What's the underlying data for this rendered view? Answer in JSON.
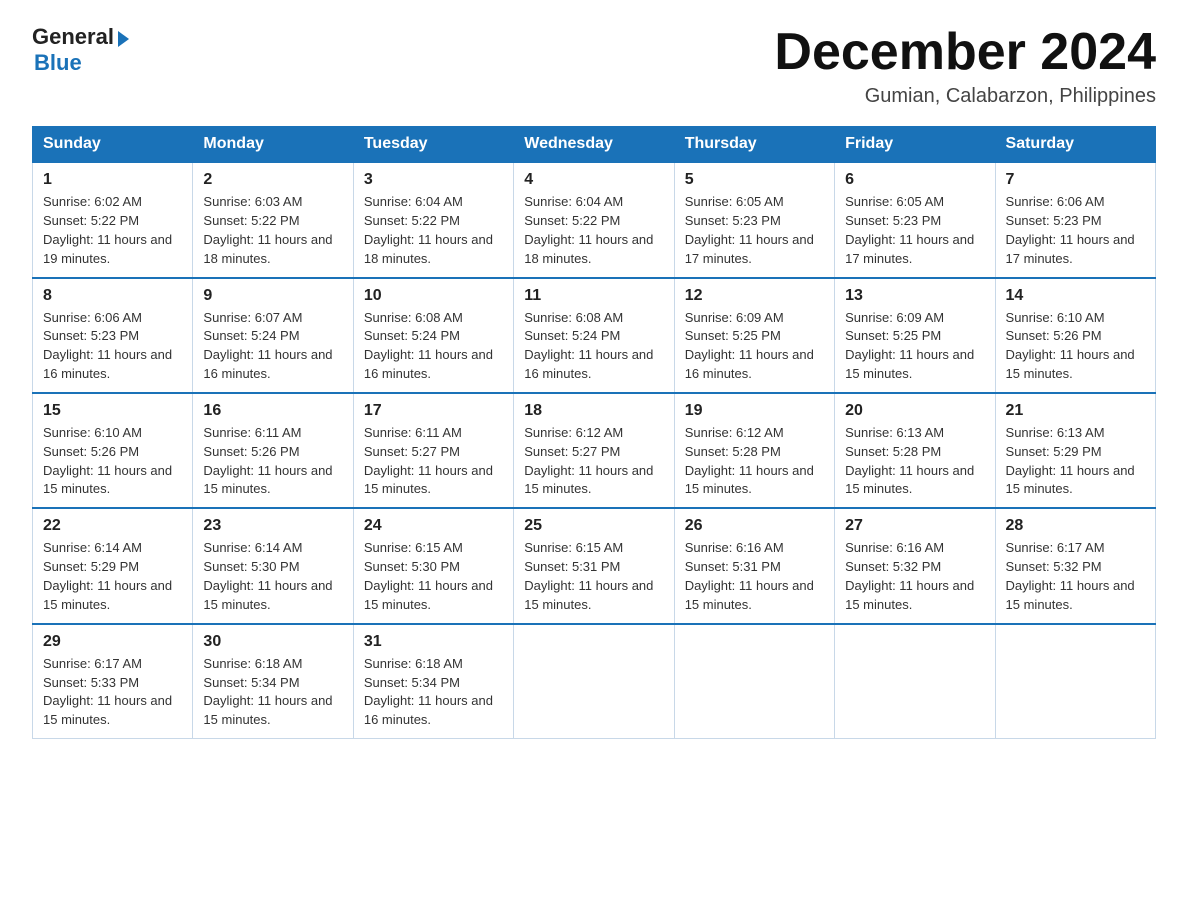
{
  "header": {
    "logo_general": "General",
    "logo_blue": "Blue",
    "month_title": "December 2024",
    "location": "Gumian, Calabarzon, Philippines"
  },
  "calendar": {
    "days_of_week": [
      "Sunday",
      "Monday",
      "Tuesday",
      "Wednesday",
      "Thursday",
      "Friday",
      "Saturday"
    ],
    "weeks": [
      [
        {
          "day": "1",
          "sunrise": "Sunrise: 6:02 AM",
          "sunset": "Sunset: 5:22 PM",
          "daylight": "Daylight: 11 hours and 19 minutes."
        },
        {
          "day": "2",
          "sunrise": "Sunrise: 6:03 AM",
          "sunset": "Sunset: 5:22 PM",
          "daylight": "Daylight: 11 hours and 18 minutes."
        },
        {
          "day": "3",
          "sunrise": "Sunrise: 6:04 AM",
          "sunset": "Sunset: 5:22 PM",
          "daylight": "Daylight: 11 hours and 18 minutes."
        },
        {
          "day": "4",
          "sunrise": "Sunrise: 6:04 AM",
          "sunset": "Sunset: 5:22 PM",
          "daylight": "Daylight: 11 hours and 18 minutes."
        },
        {
          "day": "5",
          "sunrise": "Sunrise: 6:05 AM",
          "sunset": "Sunset: 5:23 PM",
          "daylight": "Daylight: 11 hours and 17 minutes."
        },
        {
          "day": "6",
          "sunrise": "Sunrise: 6:05 AM",
          "sunset": "Sunset: 5:23 PM",
          "daylight": "Daylight: 11 hours and 17 minutes."
        },
        {
          "day": "7",
          "sunrise": "Sunrise: 6:06 AM",
          "sunset": "Sunset: 5:23 PM",
          "daylight": "Daylight: 11 hours and 17 minutes."
        }
      ],
      [
        {
          "day": "8",
          "sunrise": "Sunrise: 6:06 AM",
          "sunset": "Sunset: 5:23 PM",
          "daylight": "Daylight: 11 hours and 16 minutes."
        },
        {
          "day": "9",
          "sunrise": "Sunrise: 6:07 AM",
          "sunset": "Sunset: 5:24 PM",
          "daylight": "Daylight: 11 hours and 16 minutes."
        },
        {
          "day": "10",
          "sunrise": "Sunrise: 6:08 AM",
          "sunset": "Sunset: 5:24 PM",
          "daylight": "Daylight: 11 hours and 16 minutes."
        },
        {
          "day": "11",
          "sunrise": "Sunrise: 6:08 AM",
          "sunset": "Sunset: 5:24 PM",
          "daylight": "Daylight: 11 hours and 16 minutes."
        },
        {
          "day": "12",
          "sunrise": "Sunrise: 6:09 AM",
          "sunset": "Sunset: 5:25 PM",
          "daylight": "Daylight: 11 hours and 16 minutes."
        },
        {
          "day": "13",
          "sunrise": "Sunrise: 6:09 AM",
          "sunset": "Sunset: 5:25 PM",
          "daylight": "Daylight: 11 hours and 15 minutes."
        },
        {
          "day": "14",
          "sunrise": "Sunrise: 6:10 AM",
          "sunset": "Sunset: 5:26 PM",
          "daylight": "Daylight: 11 hours and 15 minutes."
        }
      ],
      [
        {
          "day": "15",
          "sunrise": "Sunrise: 6:10 AM",
          "sunset": "Sunset: 5:26 PM",
          "daylight": "Daylight: 11 hours and 15 minutes."
        },
        {
          "day": "16",
          "sunrise": "Sunrise: 6:11 AM",
          "sunset": "Sunset: 5:26 PM",
          "daylight": "Daylight: 11 hours and 15 minutes."
        },
        {
          "day": "17",
          "sunrise": "Sunrise: 6:11 AM",
          "sunset": "Sunset: 5:27 PM",
          "daylight": "Daylight: 11 hours and 15 minutes."
        },
        {
          "day": "18",
          "sunrise": "Sunrise: 6:12 AM",
          "sunset": "Sunset: 5:27 PM",
          "daylight": "Daylight: 11 hours and 15 minutes."
        },
        {
          "day": "19",
          "sunrise": "Sunrise: 6:12 AM",
          "sunset": "Sunset: 5:28 PM",
          "daylight": "Daylight: 11 hours and 15 minutes."
        },
        {
          "day": "20",
          "sunrise": "Sunrise: 6:13 AM",
          "sunset": "Sunset: 5:28 PM",
          "daylight": "Daylight: 11 hours and 15 minutes."
        },
        {
          "day": "21",
          "sunrise": "Sunrise: 6:13 AM",
          "sunset": "Sunset: 5:29 PM",
          "daylight": "Daylight: 11 hours and 15 minutes."
        }
      ],
      [
        {
          "day": "22",
          "sunrise": "Sunrise: 6:14 AM",
          "sunset": "Sunset: 5:29 PM",
          "daylight": "Daylight: 11 hours and 15 minutes."
        },
        {
          "day": "23",
          "sunrise": "Sunrise: 6:14 AM",
          "sunset": "Sunset: 5:30 PM",
          "daylight": "Daylight: 11 hours and 15 minutes."
        },
        {
          "day": "24",
          "sunrise": "Sunrise: 6:15 AM",
          "sunset": "Sunset: 5:30 PM",
          "daylight": "Daylight: 11 hours and 15 minutes."
        },
        {
          "day": "25",
          "sunrise": "Sunrise: 6:15 AM",
          "sunset": "Sunset: 5:31 PM",
          "daylight": "Daylight: 11 hours and 15 minutes."
        },
        {
          "day": "26",
          "sunrise": "Sunrise: 6:16 AM",
          "sunset": "Sunset: 5:31 PM",
          "daylight": "Daylight: 11 hours and 15 minutes."
        },
        {
          "day": "27",
          "sunrise": "Sunrise: 6:16 AM",
          "sunset": "Sunset: 5:32 PM",
          "daylight": "Daylight: 11 hours and 15 minutes."
        },
        {
          "day": "28",
          "sunrise": "Sunrise: 6:17 AM",
          "sunset": "Sunset: 5:32 PM",
          "daylight": "Daylight: 11 hours and 15 minutes."
        }
      ],
      [
        {
          "day": "29",
          "sunrise": "Sunrise: 6:17 AM",
          "sunset": "Sunset: 5:33 PM",
          "daylight": "Daylight: 11 hours and 15 minutes."
        },
        {
          "day": "30",
          "sunrise": "Sunrise: 6:18 AM",
          "sunset": "Sunset: 5:34 PM",
          "daylight": "Daylight: 11 hours and 15 minutes."
        },
        {
          "day": "31",
          "sunrise": "Sunrise: 6:18 AM",
          "sunset": "Sunset: 5:34 PM",
          "daylight": "Daylight: 11 hours and 16 minutes."
        },
        null,
        null,
        null,
        null
      ]
    ]
  }
}
